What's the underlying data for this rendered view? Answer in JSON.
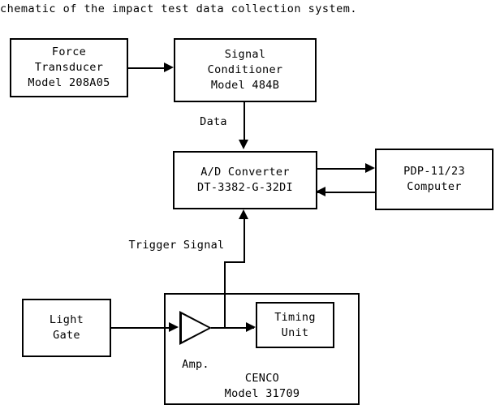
{
  "caption": {
    "text": "chematic of the impact test data collection system."
  },
  "blocks": {
    "force_transducer": {
      "line1": "Force",
      "line2": "Transducer",
      "line3": "Model 208A05"
    },
    "signal_conditioner": {
      "line1": "Signal",
      "line2": "Conditioner",
      "line3": "Model 484B"
    },
    "ad_converter": {
      "line1": "A/D Converter",
      "line2": "DT-3382-G-32DI"
    },
    "computer": {
      "line1": "PDP-11/23",
      "line2": "Computer"
    },
    "light_gate": {
      "line1": "Light",
      "line2": "Gate"
    },
    "timing_unit": {
      "line1": "Timing",
      "line2": "Unit"
    },
    "cenco": {
      "line1": "CENCO",
      "line2": "Model 31709"
    }
  },
  "labels": {
    "data": "Data",
    "trigger_signal": "Trigger Signal",
    "amp": "Amp."
  },
  "colors": {
    "stroke": "#000000",
    "background": "#ffffff"
  }
}
